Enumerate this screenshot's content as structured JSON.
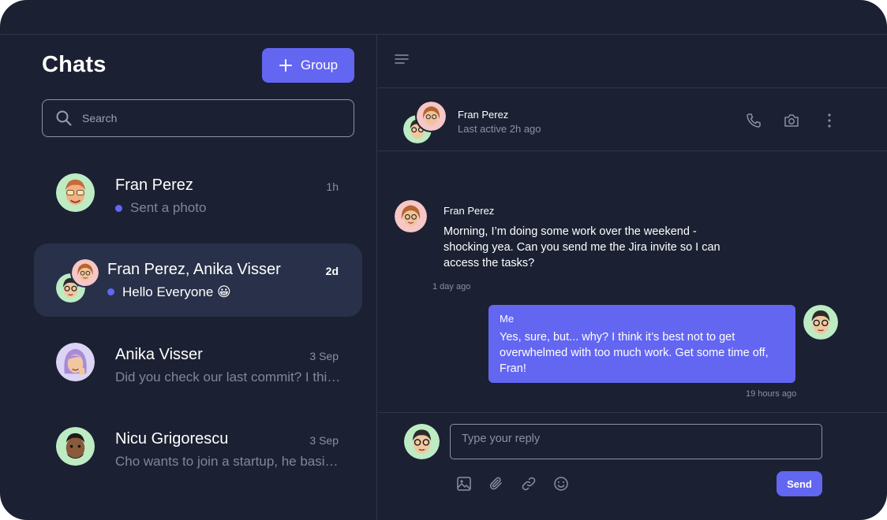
{
  "colors": {
    "background": "#1b2132",
    "accent": "#6366f1",
    "active_row": "#283149",
    "muted": "#8a91a3"
  },
  "sidebar": {
    "title": "Chats",
    "group_button": {
      "icon": "plus-icon",
      "label": "Group"
    },
    "search": {
      "icon": "search-icon",
      "placeholder": "Search"
    },
    "conversations": [
      {
        "name": "Fran Perez",
        "time": "1h",
        "preview": "Sent a photo",
        "unread": true,
        "active": false
      },
      {
        "name": "Fran Perez, Anika Visser",
        "time": "2d",
        "preview": "Hello Everyone 😀",
        "unread": true,
        "active": true
      },
      {
        "name": "Anika Visser",
        "time": "3 Sep",
        "preview": "Did you check our last commit? I think we should merge it",
        "unread": false,
        "active": false
      },
      {
        "name": "Nicu Grigorescu",
        "time": "3 Sep",
        "preview": "Cho wants to join a startup, he basically told us",
        "unread": false,
        "active": false
      }
    ]
  },
  "chat": {
    "menu_icon": "hamburger-menu-icon",
    "header": {
      "name": "Fran Perez",
      "status": "Last active 2h ago",
      "icons": [
        "phone-icon",
        "camera-icon",
        "more-vertical-icon"
      ]
    },
    "messages": [
      {
        "sender": "Fran Perez",
        "text": "Morning, I’m doing some work over the weekend - shocking yea. Can you send me the Jira invite so I can access the tasks?",
        "time": "1 day ago",
        "mine": false
      },
      {
        "sender": "Me",
        "text": "Yes, sure, but... why? I think it’s best not to get overwhelmed with too much work. Get some time off, Fran!",
        "time": "19 hours ago",
        "mine": true
      }
    ],
    "composer": {
      "placeholder": "Type your reply",
      "tools": [
        "image-icon",
        "paperclip-icon",
        "link-icon",
        "emoji-icon"
      ],
      "send_label": "Send"
    }
  }
}
